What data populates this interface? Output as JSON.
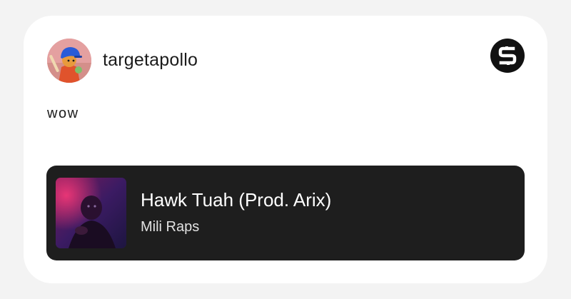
{
  "post": {
    "username": "targetapollo",
    "text": "wow",
    "avatar_icon": "cartoon-batter-avatar",
    "brand_icon": "s-logo-icon"
  },
  "track": {
    "title": "Hawk Tuah (Prod. Arix)",
    "artist": "Mili Raps",
    "cover_icon": "album-art"
  },
  "colors": {
    "page_background": "#f3f3f3",
    "card_background": "#ffffff",
    "track_background": "#1e1e1e",
    "brand_icon_background": "#111111"
  }
}
